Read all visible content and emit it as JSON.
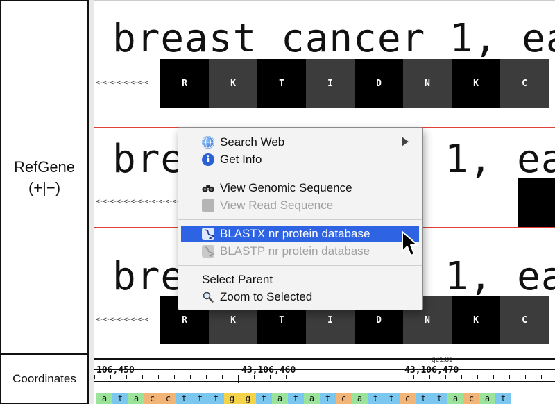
{
  "track": {
    "name": "RefGene",
    "strand": "(+|−)"
  },
  "coordinates": {
    "label": "Coordinates",
    "band": "q21.31",
    "majors": [
      "106,450",
      "43,106,460",
      "43,106,470"
    ],
    "bases": [
      "a",
      "t",
      "a",
      "c",
      "c",
      "t",
      "t",
      "t",
      "g",
      "g",
      "t",
      "a",
      "t",
      "a",
      "t",
      "c",
      "a",
      "t",
      "t",
      "c",
      "t",
      "t",
      "a",
      "c",
      "a",
      "t"
    ],
    "base_colors": {
      "a": "#9be29b",
      "t": "#7cc7f0",
      "c": "#f2b477",
      "g": "#f4d24a"
    }
  },
  "rows": [
    {
      "title": "breast cancer 1, ea",
      "dashes": "<-<-<-<-<-<-<-<",
      "aa": [
        "R",
        "K",
        "T",
        "I",
        "D",
        "N",
        "K",
        "C"
      ]
    },
    {
      "title": "bre",
      "title_right": "1, ea",
      "dashes": "<-<-<-<-<-<-<-<-<-<-<-<-<-<-<-<-<-<-<-<-<-<-<-<-<-<-<-<-<-<-<-<-<"
    },
    {
      "title": "bre",
      "title_right": "1, ea",
      "dashes": "<-<-<-<-<-<-<-<",
      "aa": [
        "R",
        "K",
        "T",
        "I",
        "D",
        "N",
        "K",
        "C"
      ]
    }
  ],
  "menu": {
    "items": [
      {
        "label": "Search Web",
        "icon": "globe-icon",
        "submenu": true
      },
      {
        "label": "Get Info",
        "icon": "info-icon"
      },
      {
        "label": "View Genomic Sequence",
        "icon": "binoculars-icon"
      },
      {
        "label": "View Read Sequence",
        "icon": "read-sequence-icon",
        "disabled": true
      },
      {
        "label": "BLASTX nr protein database",
        "icon": "blast-icon",
        "selected": true
      },
      {
        "label": "BLASTP nr protein database",
        "icon": "blast-icon",
        "disabled": true
      },
      {
        "label": "Select Parent"
      },
      {
        "label": "Zoom to Selected",
        "icon": "magnifier-icon"
      }
    ]
  },
  "colors": {
    "selection": "#2e63e3",
    "row_divider": "#e0403a",
    "aa_dark": "#000000",
    "aa_gray": "#3c3c3c"
  }
}
